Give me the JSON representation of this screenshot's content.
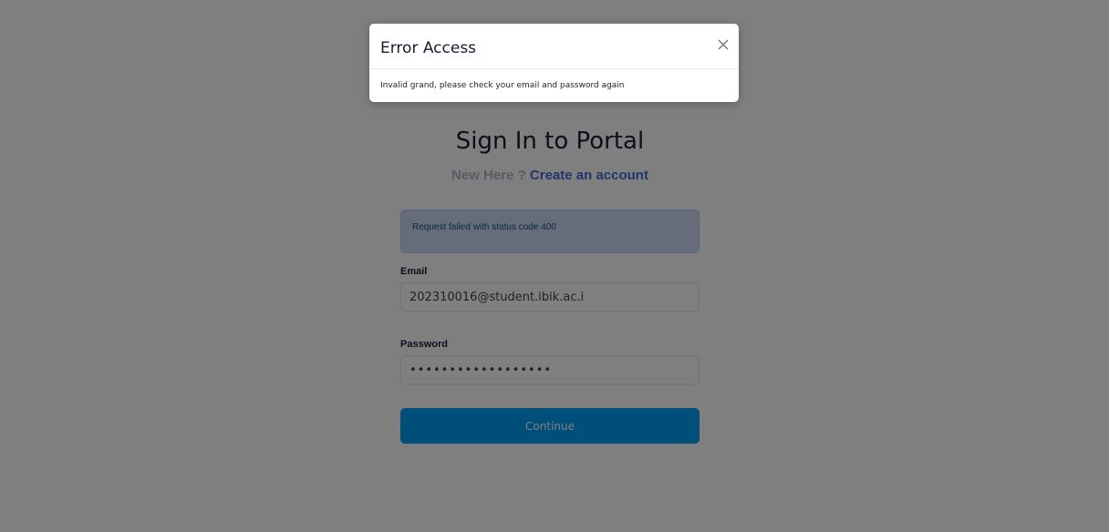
{
  "login": {
    "title": "Sign In to Portal",
    "new_here": "New Here ?",
    "create_account": "Create an account",
    "alert_message": "Request failed with status code 400",
    "email_label": "Email",
    "email_value": "202310016@student.ibik.ac.i",
    "password_label": "Password",
    "password_value": "••••••••••••••••••",
    "continue_label": "Continue"
  },
  "modal": {
    "title": "Error Access",
    "message": "Invalid grand, please check your email and password again",
    "close_icon": "close-icon"
  },
  "colors": {
    "primary_button": "#009ef7",
    "link": "#3f6ad8",
    "alert_bg": "#c8daf3",
    "backdrop": "rgba(0,0,0,0.5)"
  }
}
